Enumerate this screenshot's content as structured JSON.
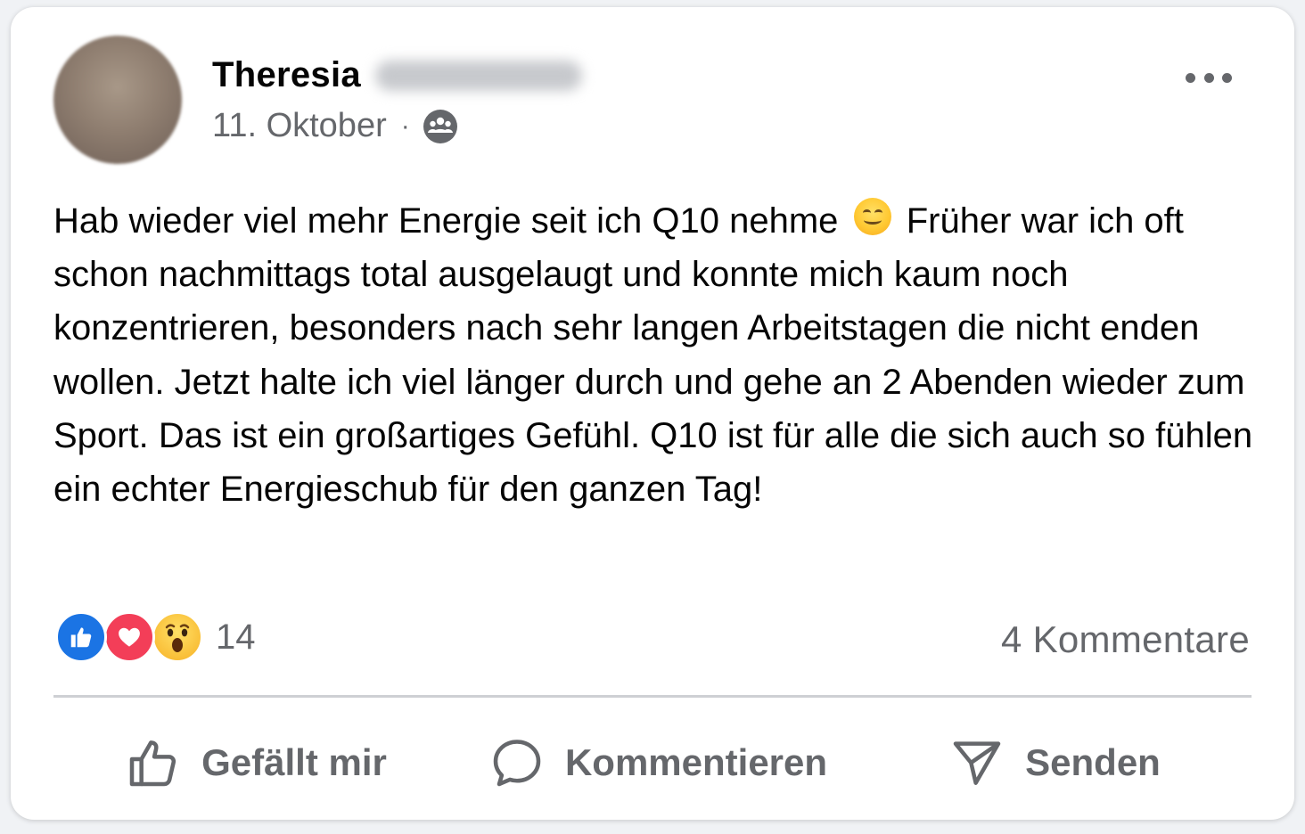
{
  "post": {
    "author_first_name": "Theresia",
    "date": "11. Oktober",
    "separator": "·",
    "audience_icon": "group-icon",
    "text_part1": "Hab wieder viel mehr Energie seit ich Q10 nehme",
    "text_part2": "Früher war ich oft schon nachmittags total ausgelaugt und konnte mich kaum noch konzentrieren, besonders nach sehr langen Arbeitstagen die nicht enden wollen. Jetzt halte ich viel länger durch und gehe an 2 Abenden wieder zum Sport. Das ist ein großartiges Gefühl. Q10 ist für alle die sich auch so fühlen ein echter Energieschub für den ganzen Tag!"
  },
  "reactions": {
    "types": [
      "like",
      "love",
      "wow"
    ],
    "count": "14"
  },
  "comments_label": "4 Kommentare",
  "actions": {
    "like_label": "Gefällt mir",
    "comment_label": "Kommentieren",
    "send_label": "Senden"
  },
  "colors": {
    "like_blue": "#1b74e4",
    "love_red": "#f33e58",
    "secondary_text": "#65676b"
  }
}
